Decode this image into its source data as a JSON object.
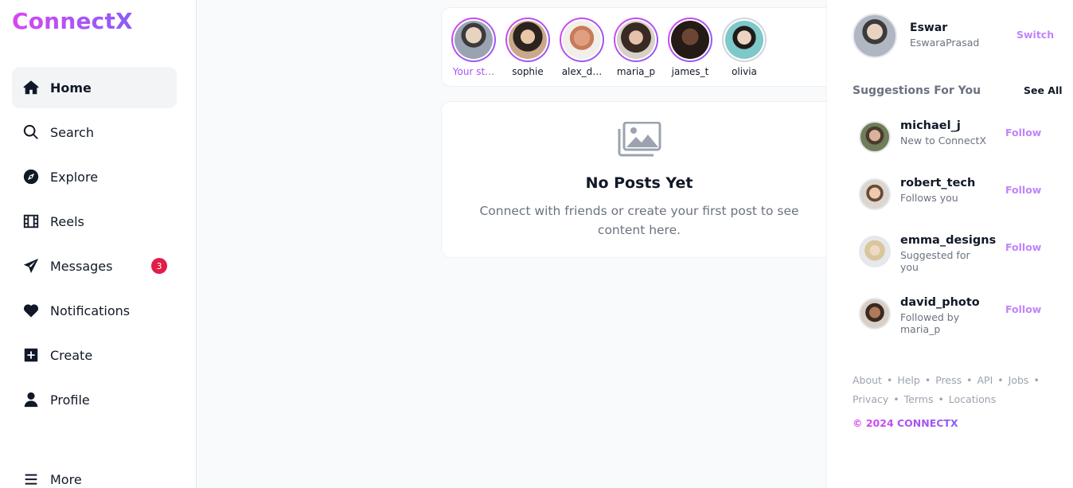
{
  "app": {
    "name": "ConnectX"
  },
  "sidebar": {
    "items": [
      {
        "label": "Home",
        "icon": "home-icon",
        "active": true
      },
      {
        "label": "Search",
        "icon": "search-icon"
      },
      {
        "label": "Explore",
        "icon": "compass-icon"
      },
      {
        "label": "Reels",
        "icon": "film-icon"
      },
      {
        "label": "Messages",
        "icon": "paper-plane-icon",
        "badge": "3"
      },
      {
        "label": "Notifications",
        "icon": "heart-icon"
      },
      {
        "label": "Create",
        "icon": "plus-square-icon"
      },
      {
        "label": "Profile",
        "icon": "user-icon"
      },
      {
        "label": "More",
        "icon": "menu-icon"
      }
    ]
  },
  "stories": [
    {
      "name": "Your st…",
      "own": true
    },
    {
      "name": "sophie"
    },
    {
      "name": "alex_d…"
    },
    {
      "name": "maria_p"
    },
    {
      "name": "james_t"
    },
    {
      "name": "olivia",
      "seen": true
    }
  ],
  "feed": {
    "empty_icon": "images-icon",
    "empty_title": "No Posts Yet",
    "empty_text": "Connect with friends or create your first post to see content here."
  },
  "account": {
    "name": "Eswar",
    "handle": "EswaraPrasad",
    "switch_label": "Switch"
  },
  "suggestions": {
    "title": "Suggestions For You",
    "see_all": "See All",
    "items": [
      {
        "name": "michael_j",
        "sub": "New to ConnectX",
        "action": "Follow"
      },
      {
        "name": "robert_tech",
        "sub": "Follows you",
        "action": "Follow"
      },
      {
        "name": "emma_designs",
        "sub": "Suggested for you",
        "action": "Follow"
      },
      {
        "name": "david_photo",
        "sub": "Followed by maria_p",
        "action": "Follow"
      }
    ]
  },
  "footer": {
    "links": [
      "About",
      "Help",
      "Press",
      "API",
      "Jobs",
      "Privacy",
      "Terms",
      "Locations"
    ],
    "copyright": "© 2024 CONNECTX"
  },
  "colors": {
    "accent": "#a855f7",
    "brand_gradient_start": "#d946ef",
    "badge": "#e11d48"
  }
}
